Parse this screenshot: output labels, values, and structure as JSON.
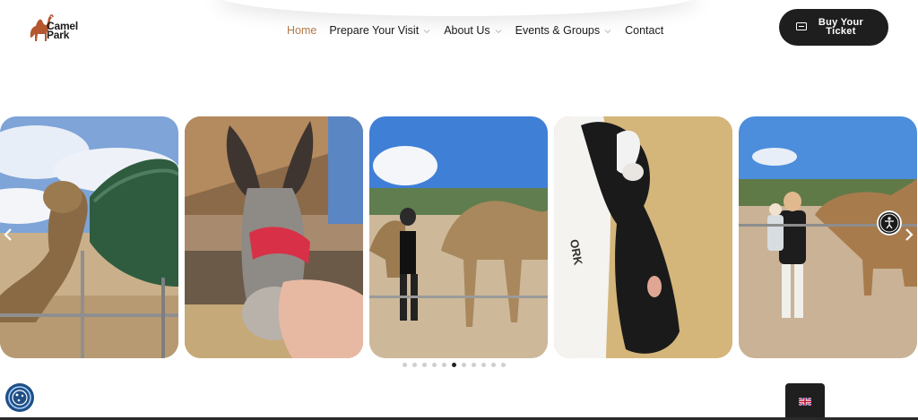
{
  "brand": {
    "name": "Camel Park",
    "line1": "Camel",
    "line2": "Park",
    "accent": "#b07a4a"
  },
  "nav": {
    "items": [
      {
        "label": "Home",
        "active": true,
        "dropdown": false
      },
      {
        "label": "Prepare Your Visit",
        "active": false,
        "dropdown": true
      },
      {
        "label": "About Us",
        "active": false,
        "dropdown": true
      },
      {
        "label": "Events & Groups",
        "active": false,
        "dropdown": true
      },
      {
        "label": "Contact",
        "active": false,
        "dropdown": false
      }
    ]
  },
  "cta": {
    "line1": "Buy Your",
    "line2": "Ticket",
    "icon": "ticket-icon"
  },
  "gallery": {
    "slides": [
      {
        "name": "camel-feeding-trough"
      },
      {
        "name": "donkey-being-fed"
      },
      {
        "name": "visitor-with-camels"
      },
      {
        "name": "baby-goat-held"
      },
      {
        "name": "family-with-camel"
      }
    ],
    "dots_total": 11,
    "dots_active": 5
  },
  "language": {
    "flag": "uk-flag-icon"
  },
  "icons": {
    "prev": "chevron-left-icon",
    "next": "chevron-right-icon",
    "accessibility": "accessibility-icon",
    "cookie": "cookie-settings-icon"
  }
}
